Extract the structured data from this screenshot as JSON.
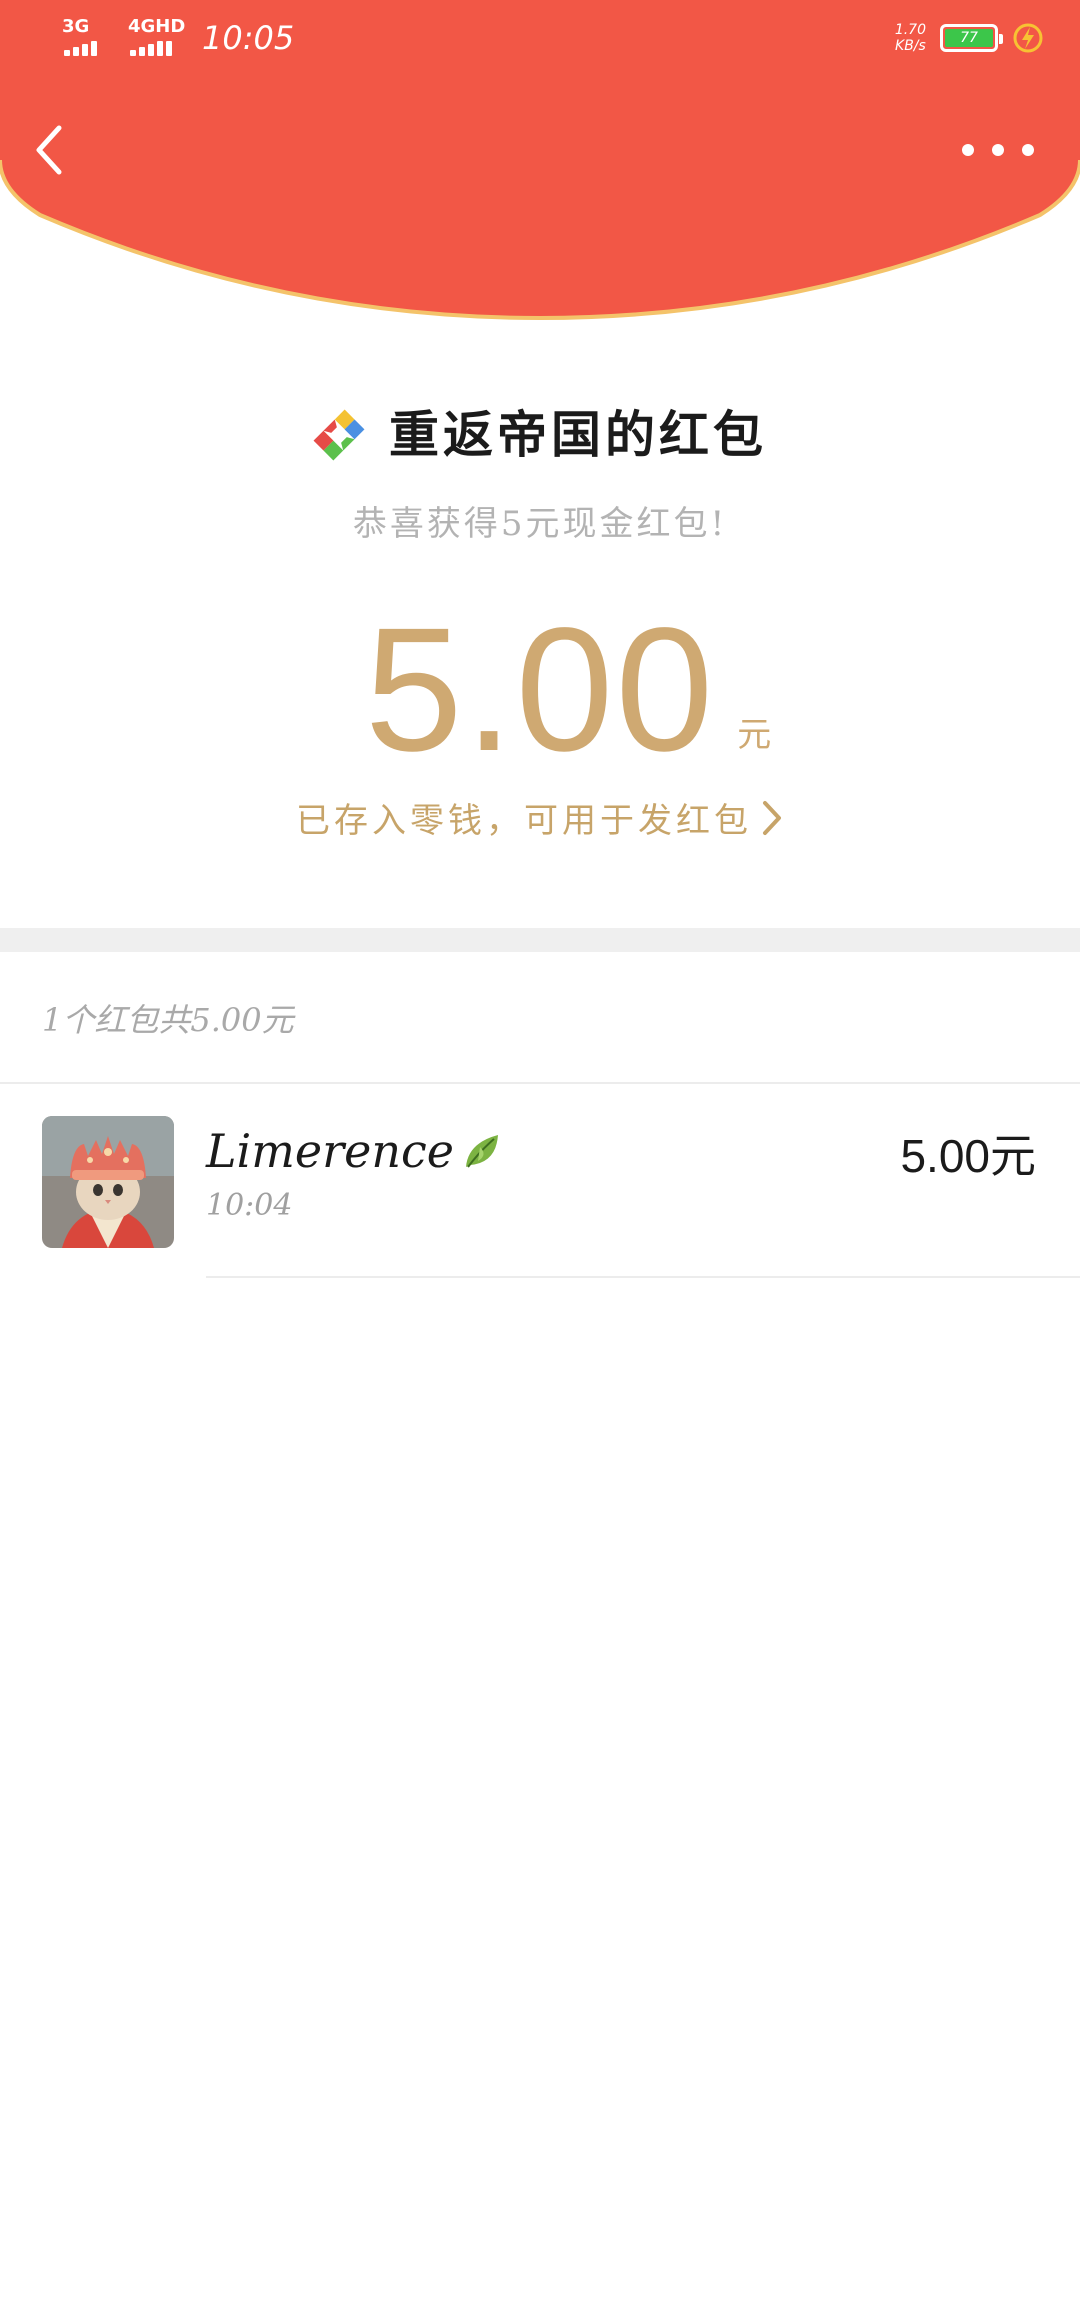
{
  "status_bar": {
    "network_1": "3G",
    "network_2": "4GHD",
    "time": "10:05",
    "speed_value": "1.70",
    "speed_unit": "KB/s",
    "battery_level": "77",
    "battery_color": "#3cc64a"
  },
  "header": {
    "color": "#f25746",
    "border_color": "#f4c36a"
  },
  "packet": {
    "sender_title": "重返帝国的红包",
    "subtitle": "恭喜获得5元现金红包!",
    "amount": "5.00",
    "amount_unit": "元",
    "wallet_link": "已存入零钱，可用于发红包",
    "amount_color": "#cfa972"
  },
  "summary": {
    "text": "1个红包共5.00元"
  },
  "receivers": [
    {
      "name": "Limerence",
      "time": "10:04",
      "amount": "5.00元",
      "avatar": "cat-avatar"
    }
  ]
}
